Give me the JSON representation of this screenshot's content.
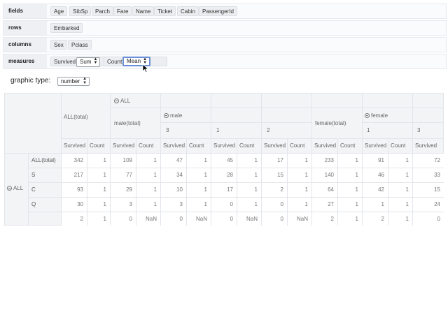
{
  "config": {
    "fields": {
      "label": "fields",
      "items": [
        "Age",
        "SibSp",
        "Parch",
        "Fare",
        "Name",
        "Ticket",
        "Cabin",
        "PassengerId"
      ]
    },
    "rows": {
      "label": "rows",
      "items": [
        "Embarked"
      ]
    },
    "columns": {
      "label": "columns",
      "items": [
        "Sex",
        "Pclass"
      ]
    },
    "measures": {
      "label": "measures",
      "items": [
        {
          "field": "Survived",
          "agg": "Sum"
        },
        {
          "field": "Count",
          "agg": "Mean"
        }
      ]
    }
  },
  "graphic_type": {
    "label": "graphic type:",
    "value": "number"
  },
  "pivot": {
    "top_header": "ALL",
    "col_totals": {
      "all_total": "ALL(total)",
      "male_total": "male(total)",
      "female_total": "female(total)"
    },
    "sex_groups": {
      "male": "male",
      "female": "female"
    },
    "pclass": {
      "male": [
        "3",
        "1",
        "2"
      ],
      "female": [
        "1",
        "3"
      ]
    },
    "measure_names": [
      "Survived",
      "Count"
    ],
    "row_dimension_label": "ALL",
    "row_labels": [
      "ALL(total)",
      "S",
      "C",
      "Q",
      ""
    ],
    "rows": [
      [
        "342",
        "1",
        "109",
        "1",
        "47",
        "1",
        "45",
        "1",
        "17",
        "1",
        "233",
        "1",
        "91",
        "1",
        "72"
      ],
      [
        "217",
        "1",
        "77",
        "1",
        "34",
        "1",
        "28",
        "1",
        "15",
        "1",
        "140",
        "1",
        "46",
        "1",
        "33"
      ],
      [
        "93",
        "1",
        "29",
        "1",
        "10",
        "1",
        "17",
        "1",
        "2",
        "1",
        "64",
        "1",
        "42",
        "1",
        "15"
      ],
      [
        "30",
        "1",
        "3",
        "1",
        "3",
        "1",
        "0",
        "1",
        "0",
        "1",
        "27",
        "1",
        "1",
        "1",
        "24"
      ],
      [
        "2",
        "1",
        "0",
        "NaN",
        "0",
        "NaN",
        "0",
        "NaN",
        "0",
        "NaN",
        "2",
        "1",
        "2",
        "1",
        "0"
      ]
    ]
  }
}
